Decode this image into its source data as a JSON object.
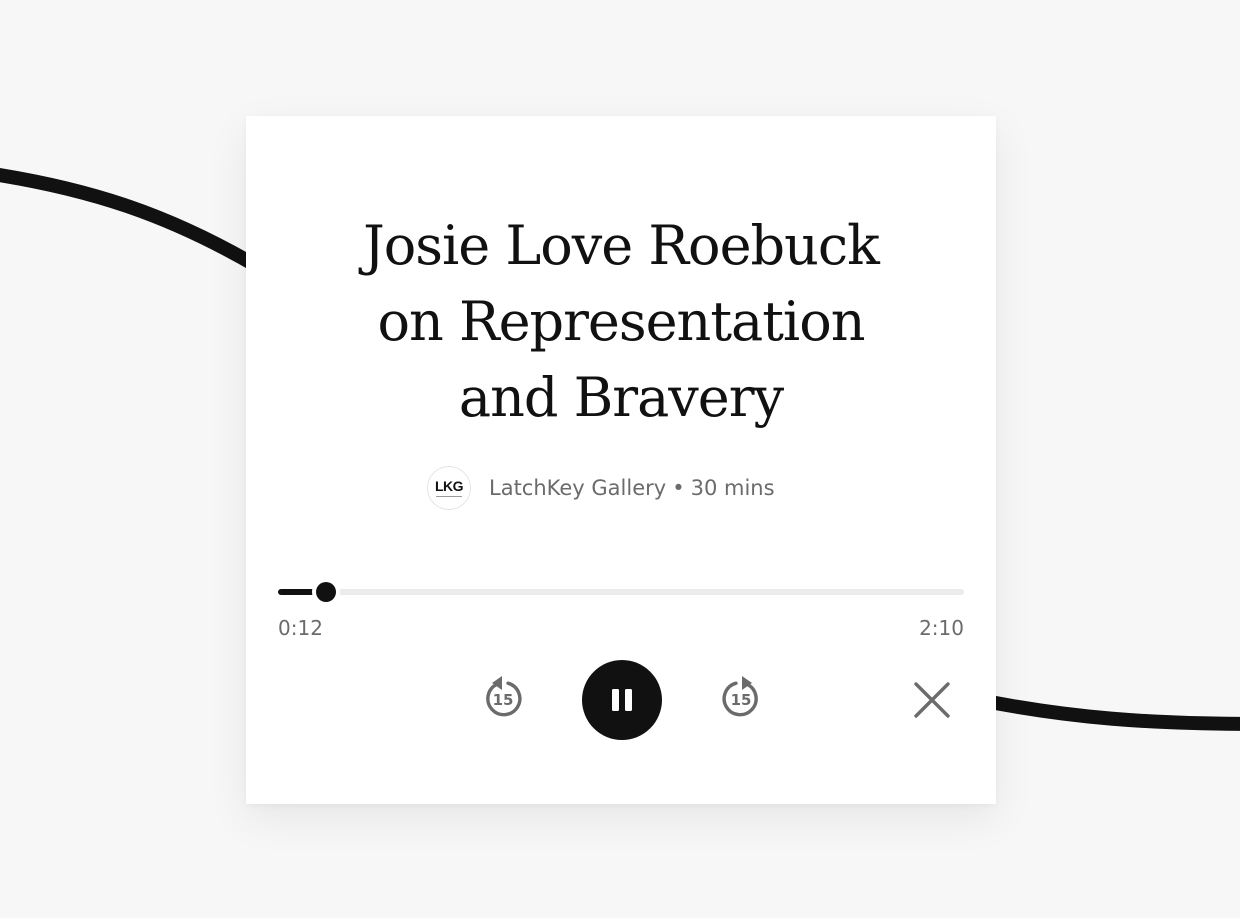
{
  "player": {
    "title_lines": [
      "Josie Love Roebuck",
      "on Representation",
      "and Bravery"
    ],
    "avatar_logo": "LKG",
    "publisher": "LatchKey Gallery",
    "separator": "•",
    "duration": "30 mins",
    "current_time": "0:12",
    "total_time": "2:10",
    "progress_fraction": 0.07,
    "rewind_seconds": "15",
    "forward_seconds": "15",
    "state": "playing"
  },
  "icons": {
    "rewind": "rewind-15-icon",
    "pause": "pause-icon",
    "forward": "forward-15-icon",
    "close": "close-icon"
  },
  "colors": {
    "background": "#f7f7f7",
    "card": "#ffffff",
    "accent": "#111111",
    "muted_text": "#6b6b6b",
    "track": "#ebebeb"
  }
}
